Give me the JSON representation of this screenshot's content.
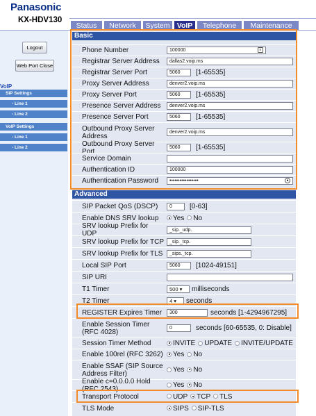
{
  "brand": {
    "logo": "Panasonic",
    "model": "KX-HDV130"
  },
  "tabs": [
    {
      "label": "Status"
    },
    {
      "label": "Network"
    },
    {
      "label": "System"
    },
    {
      "label": "VoIP"
    },
    {
      "label": "Telephone"
    },
    {
      "label": "Maintenance"
    }
  ],
  "sidebar": {
    "logout_label": "Logout",
    "webport_label": "Web Port Close",
    "voip_heading": "VoIP",
    "nav": [
      {
        "label": "SIP Settings"
      },
      {
        "label": "- Line 1"
      },
      {
        "label": "- Line 2"
      },
      {
        "label": "VoIP Settings"
      },
      {
        "label": "- Line 1"
      },
      {
        "label": "- Line 2"
      }
    ]
  },
  "basic": {
    "title": "Basic",
    "rows": [
      {
        "label": "Phone Number",
        "value": "100000"
      },
      {
        "label": "Registrar Server Address",
        "value": "dallas2.voip.ms"
      },
      {
        "label": "Registrar Server Port",
        "value": "5060",
        "hint": "[1-65535]"
      },
      {
        "label": "Proxy Server Address",
        "value": "denver2.voip.ms"
      },
      {
        "label": "Proxy Server Port",
        "value": "5060",
        "hint": "[1-65535]"
      },
      {
        "label": "Presence Server Address",
        "value": "denver2.voip.ms"
      },
      {
        "label": "Presence Server Port",
        "value": "5060",
        "hint": "[1-65535]"
      },
      {
        "label": "Outbound Proxy Server Address",
        "value": "denver2.voip.ms"
      },
      {
        "label": "Outbound Proxy Server Port",
        "value": "5060",
        "hint": "[1-65535]"
      },
      {
        "label": "Service Domain",
        "value": ""
      },
      {
        "label": "Authentication ID",
        "value": "100000"
      },
      {
        "label": "Authentication Password",
        "value": "•••••••••••••••••"
      }
    ]
  },
  "advanced": {
    "title": "Advanced",
    "rows": [
      {
        "label": "SIP Packet QoS (DSCP)",
        "value": "0",
        "hint": "[0-63]"
      },
      {
        "label": "Enable DNS SRV lookup",
        "options": [
          "Yes",
          "No"
        ],
        "selected": 0
      },
      {
        "label": "SRV lookup Prefix for UDP",
        "value": "_sip._udp."
      },
      {
        "label": "SRV lookup Prefix for TCP",
        "value": "_sip._tcp."
      },
      {
        "label": "SRV lookup Prefix for TLS",
        "value": "_sips._tcp."
      },
      {
        "label": "Local SIP Port",
        "value": "5060",
        "hint": "[1024-49151]"
      },
      {
        "label": "SIP URI",
        "value": ""
      },
      {
        "label": "T1 Timer",
        "select": "500",
        "hint": "milliseconds"
      },
      {
        "label": "T2 Timer",
        "select": "4",
        "hint": "seconds"
      },
      {
        "label": "REGISTER Expires Timer",
        "value": "300",
        "hint": "seconds [1-4294967295]"
      },
      {
        "label": "Enable Session Timer (RFC 4028)",
        "value": "0",
        "hint": "seconds [60-65535, 0: Disable]"
      },
      {
        "label": "Session Timer Method",
        "options": [
          "INVITE",
          "UPDATE",
          "INVITE/UPDATE"
        ],
        "selected": 0
      },
      {
        "label": "Enable 100rel (RFC 3262)",
        "options": [
          "Yes",
          "No"
        ],
        "selected": 0
      },
      {
        "label": "Enable SSAF (SIP Source Address Filter)",
        "options": [
          "Yes",
          "No"
        ],
        "selected": 1
      },
      {
        "label": "Enable c=0.0.0.0 Hold (RFC 2543)",
        "options": [
          "Yes",
          "No"
        ],
        "selected": 1
      },
      {
        "label": "Transport Protocol",
        "options": [
          "UDP",
          "TCP",
          "TLS"
        ],
        "selected": 1
      },
      {
        "label": "TLS Mode",
        "options": [
          "SIPS",
          "SIP-TLS"
        ],
        "selected": 0
      }
    ]
  },
  "colors": {
    "highlight": "#f28c2a",
    "section_header": "#2e54a4",
    "active_tab": "#2b2f8c",
    "tab": "#7c87c6"
  }
}
